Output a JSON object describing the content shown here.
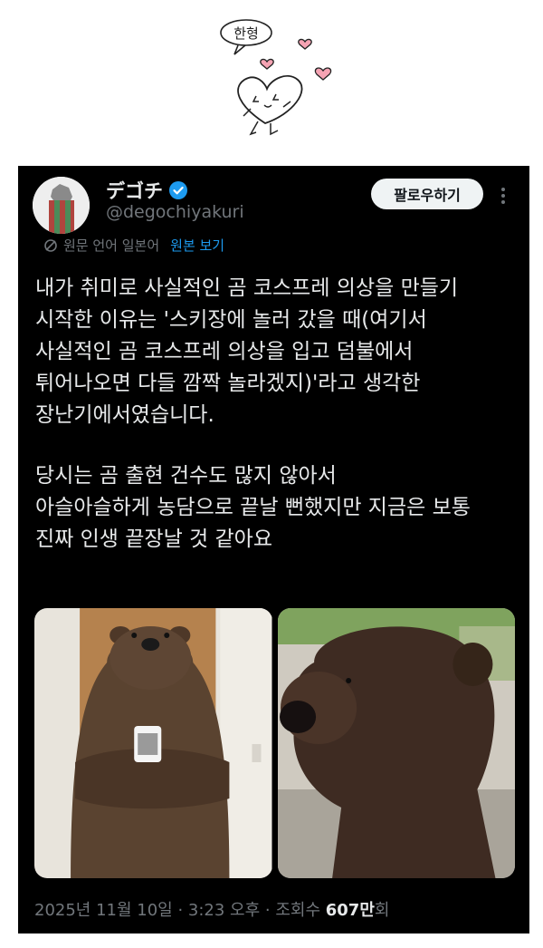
{
  "doodle": {
    "text": "한형"
  },
  "tweet": {
    "display_name": "デゴチ",
    "handle": "@degochiyakuri",
    "follow_label": "팔로우하기",
    "translation": {
      "source_text": "원문 언어 일본어",
      "link": "원본 보기"
    },
    "paragraphs": [
      "내가 취미로 사실적인 곰 코스프레 의상을 만들기\n시작한 이유는 '스키장에 놀러 갔을 때(여기서\n사실적인 곰 코스프레 의상을 입고 덤불에서\n튀어나오면 다들 깜짝 놀라겠지)'라고 생각한\n장난기에서였습니다.",
      "당시는 곰 출현 건수도 많지 않아서\n아슬아슬하게 농담으로 끝날 뻔했지만 지금은 보통\n진짜 인생 끝장날 것 같아요"
    ],
    "timestamp": "2025년 11월 10일 · 3:23 오후 · 조회수",
    "views_number": "607만",
    "views_suffix": "회",
    "colors": {
      "background": "#000000",
      "link": "#1d9bf0",
      "muted": "#71767b"
    }
  }
}
